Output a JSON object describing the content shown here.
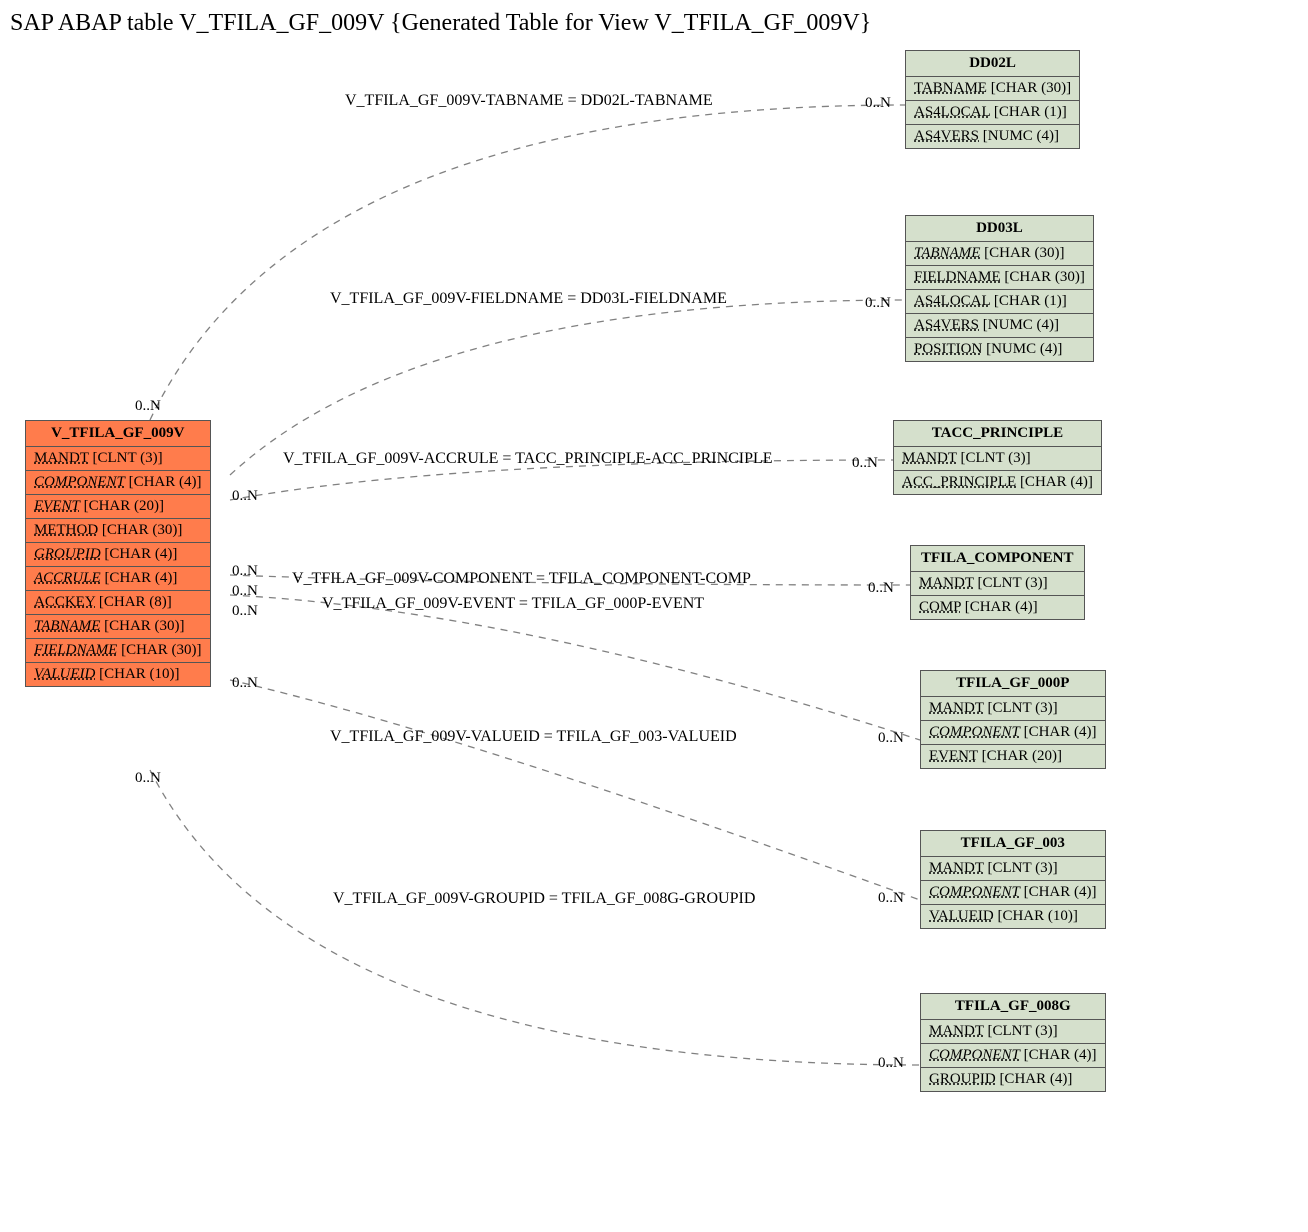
{
  "title": "SAP ABAP table V_TFILA_GF_009V {Generated Table for View V_TFILA_GF_009V}",
  "primary": {
    "name": "V_TFILA_GF_009V",
    "fields": [
      {
        "name": "MANDT",
        "type": "[CLNT (3)]",
        "italic": false
      },
      {
        "name": "COMPONENT",
        "type": "[CHAR (4)]",
        "italic": true
      },
      {
        "name": "EVENT",
        "type": "[CHAR (20)]",
        "italic": true
      },
      {
        "name": "METHOD",
        "type": "[CHAR (30)]",
        "italic": false
      },
      {
        "name": "GROUPID",
        "type": "[CHAR (4)]",
        "italic": true
      },
      {
        "name": "ACCRULE",
        "type": "[CHAR (4)]",
        "italic": true
      },
      {
        "name": "ACCKEY",
        "type": "[CHAR (8)]",
        "italic": false
      },
      {
        "name": "TABNAME",
        "type": "[CHAR (30)]",
        "italic": true
      },
      {
        "name": "FIELDNAME",
        "type": "[CHAR (30)]",
        "italic": true
      },
      {
        "name": "VALUEID",
        "type": "[CHAR (10)]",
        "italic": true
      }
    ]
  },
  "entities": [
    {
      "name": "DD02L",
      "fields": [
        {
          "name": "TABNAME",
          "type": "[CHAR (30)]",
          "italic": false
        },
        {
          "name": "AS4LOCAL",
          "type": "[CHAR (1)]",
          "italic": false
        },
        {
          "name": "AS4VERS",
          "type": "[NUMC (4)]",
          "italic": false
        }
      ]
    },
    {
      "name": "DD03L",
      "fields": [
        {
          "name": "TABNAME",
          "type": "[CHAR (30)]",
          "italic": true
        },
        {
          "name": "FIELDNAME",
          "type": "[CHAR (30)]",
          "italic": false
        },
        {
          "name": "AS4LOCAL",
          "type": "[CHAR (1)]",
          "italic": false
        },
        {
          "name": "AS4VERS",
          "type": "[NUMC (4)]",
          "italic": false
        },
        {
          "name": "POSITION",
          "type": "[NUMC (4)]",
          "italic": false
        }
      ]
    },
    {
      "name": "TACC_PRINCIPLE",
      "fields": [
        {
          "name": "MANDT",
          "type": "[CLNT (3)]",
          "italic": false
        },
        {
          "name": "ACC_PRINCIPLE",
          "type": "[CHAR (4)]",
          "italic": false
        }
      ]
    },
    {
      "name": "TFILA_COMPONENT",
      "fields": [
        {
          "name": "MANDT",
          "type": "[CLNT (3)]",
          "italic": false
        },
        {
          "name": "COMP",
          "type": "[CHAR (4)]",
          "italic": false
        }
      ]
    },
    {
      "name": "TFILA_GF_000P",
      "fields": [
        {
          "name": "MANDT",
          "type": "[CLNT (3)]",
          "italic": false
        },
        {
          "name": "COMPONENT",
          "type": "[CHAR (4)]",
          "italic": true
        },
        {
          "name": "EVENT",
          "type": "[CHAR (20)]",
          "italic": false
        }
      ]
    },
    {
      "name": "TFILA_GF_003",
      "fields": [
        {
          "name": "MANDT",
          "type": "[CLNT (3)]",
          "italic": false
        },
        {
          "name": "COMPONENT",
          "type": "[CHAR (4)]",
          "italic": true
        },
        {
          "name": "VALUEID",
          "type": "[CHAR (10)]",
          "italic": false
        }
      ]
    },
    {
      "name": "TFILA_GF_008G",
      "fields": [
        {
          "name": "MANDT",
          "type": "[CLNT (3)]",
          "italic": false
        },
        {
          "name": "COMPONENT",
          "type": "[CHAR (4)]",
          "italic": true
        },
        {
          "name": "GROUPID",
          "type": "[CHAR (4)]",
          "italic": false
        }
      ]
    }
  ],
  "relations": [
    {
      "label": "V_TFILA_GF_009V-TABNAME = DD02L-TABNAME"
    },
    {
      "label": "V_TFILA_GF_009V-FIELDNAME = DD03L-FIELDNAME"
    },
    {
      "label": "V_TFILA_GF_009V-ACCRULE = TACC_PRINCIPLE-ACC_PRINCIPLE"
    },
    {
      "label": "V_TFILA_GF_009V-COMPONENT = TFILA_COMPONENT-COMP"
    },
    {
      "label": "V_TFILA_GF_009V-EVENT = TFILA_GF_000P-EVENT"
    },
    {
      "label": "V_TFILA_GF_009V-VALUEID = TFILA_GF_003-VALUEID"
    },
    {
      "label": "V_TFILA_GF_009V-GROUPID = TFILA_GF_008G-GROUPID"
    }
  ],
  "card": "0..N"
}
